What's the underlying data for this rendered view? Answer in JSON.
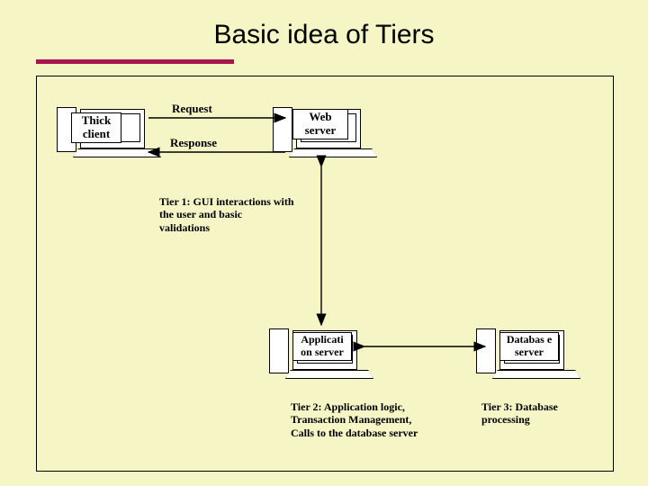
{
  "title": "Basic idea of Tiers",
  "nodes": {
    "thick_client": "Thick client",
    "web_server": "Web server",
    "app_server": "Applicati on server",
    "db_server": "Databas e server"
  },
  "arrows": {
    "request": "Request",
    "response": "Response"
  },
  "captions": {
    "tier1": "Tier 1: GUI interactions with the user and basic validations",
    "tier2": "Tier 2: Application logic, Transaction Management, Calls to the database server",
    "tier3": "Tier 3: Database processing"
  }
}
